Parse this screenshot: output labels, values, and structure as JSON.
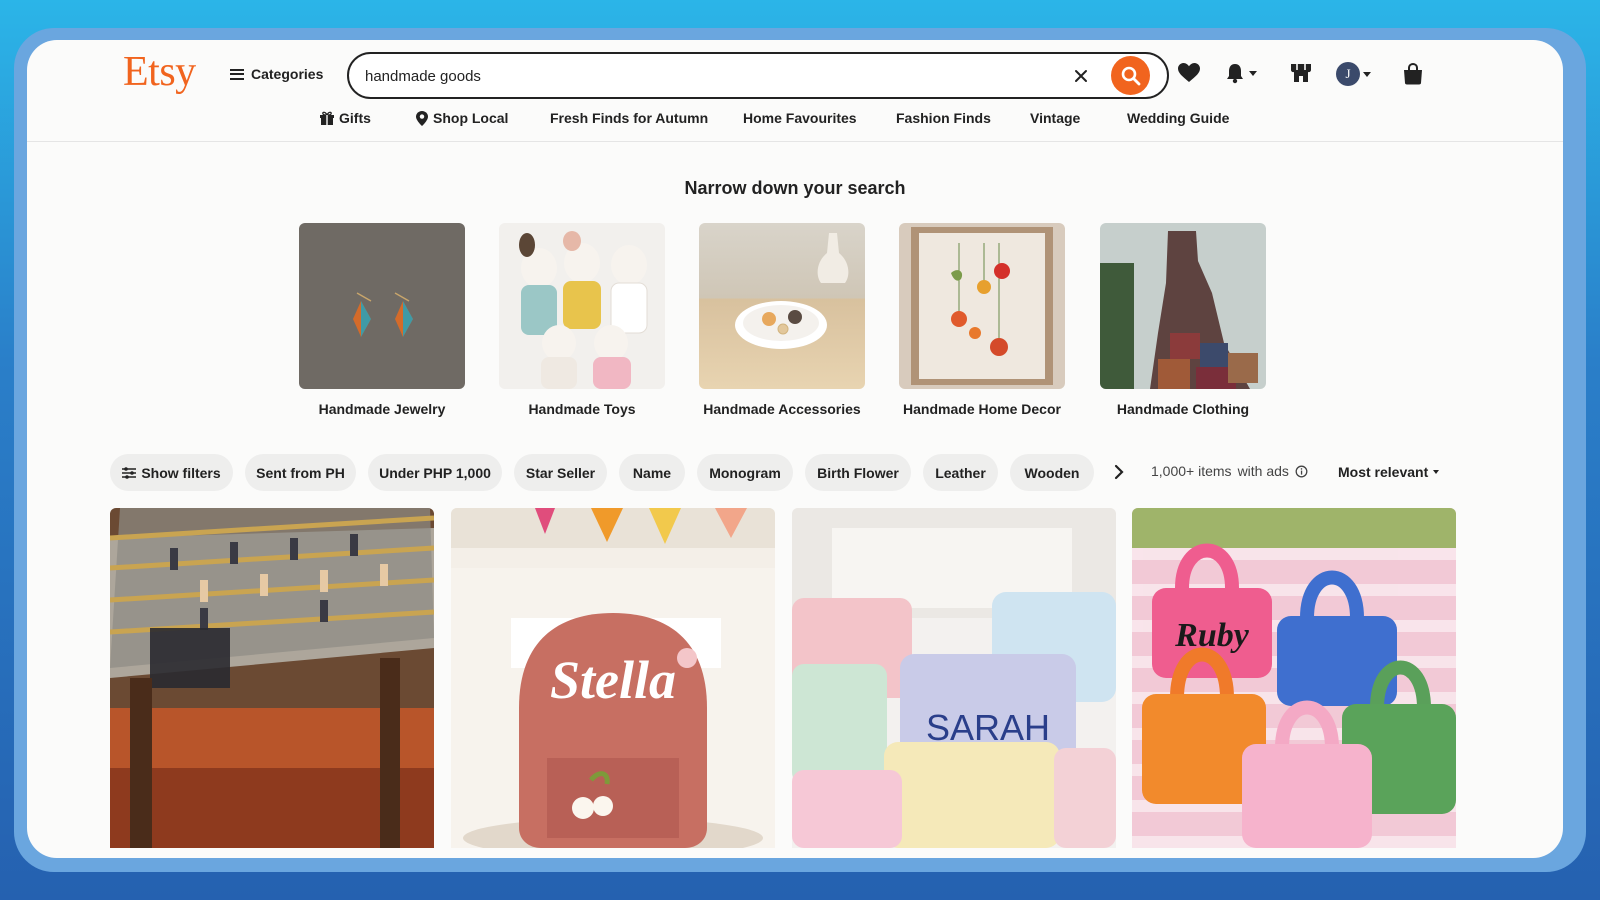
{
  "header": {
    "logo": "Etsy",
    "categories_label": "Categories",
    "search_value": "handmade goods",
    "avatar_initial": "J"
  },
  "nav": [
    {
      "label": "Gifts",
      "icon": "gift-icon"
    },
    {
      "label": "Shop Local",
      "icon": "location-pin-icon"
    },
    {
      "label": "Fresh Finds for Autumn"
    },
    {
      "label": "Home Favourites"
    },
    {
      "label": "Fashion Finds"
    },
    {
      "label": "Vintage"
    },
    {
      "label": "Wedding Guide"
    }
  ],
  "narrow": {
    "title": "Narrow down your search",
    "categories": [
      {
        "label": "Handmade Jewelry"
      },
      {
        "label": "Handmade Toys"
      },
      {
        "label": "Handmade Accessories"
      },
      {
        "label": "Handmade Home Decor"
      },
      {
        "label": "Handmade Clothing"
      }
    ]
  },
  "filters": {
    "show_filters": "Show filters",
    "chips": [
      "Sent from PH",
      "Under PHP 1,000",
      "Star Seller",
      "Name",
      "Monogram",
      "Birth Flower",
      "Leather",
      "Wooden"
    ],
    "results_count": "1,000+ items",
    "results_note": "with ads",
    "sort_label": "Most relevant"
  },
  "listings": [
    {
      "text": ""
    },
    {
      "text": "Stella"
    },
    {
      "text": "SARAH"
    },
    {
      "text": "Ruby"
    }
  ],
  "colors": {
    "accent": "#f1641e",
    "chip_bg": "#eeeeed"
  }
}
